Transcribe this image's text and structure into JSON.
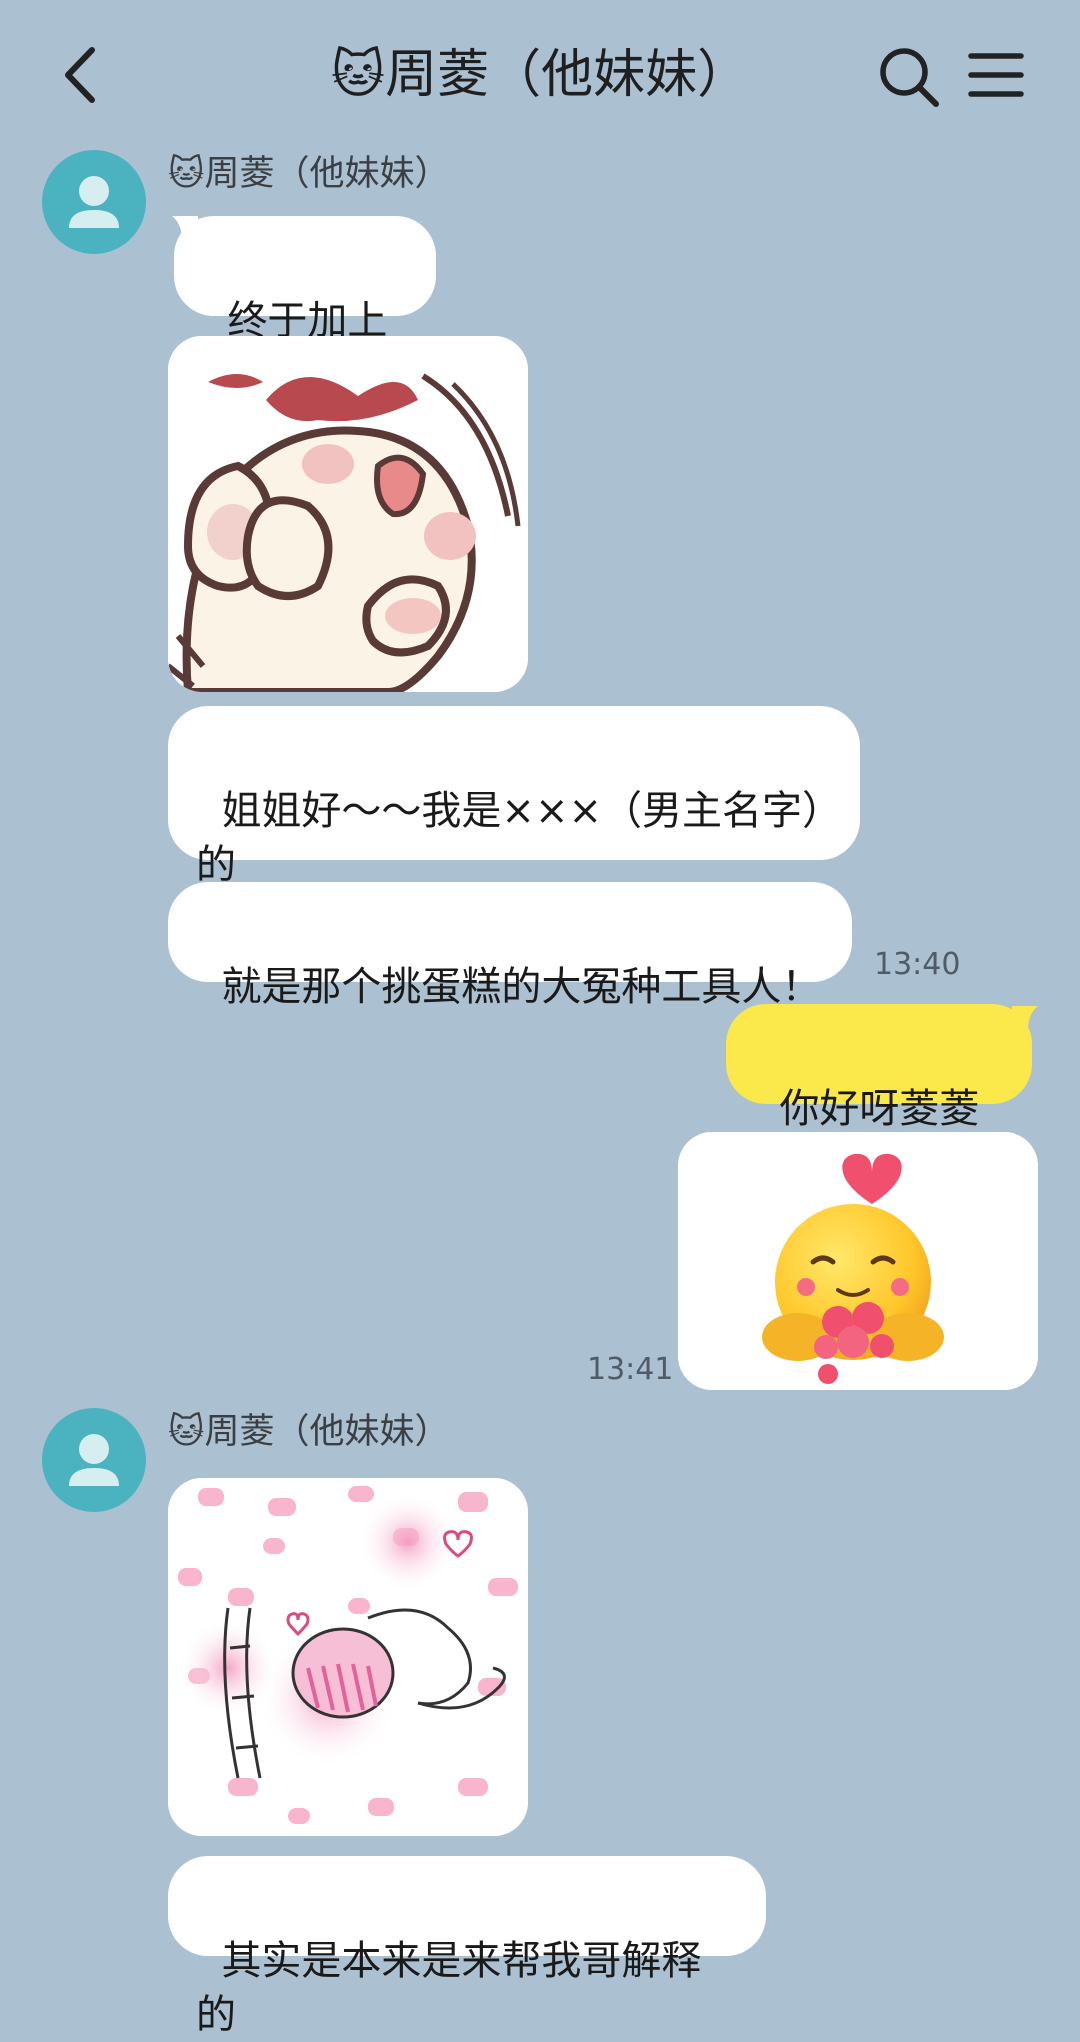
{
  "header": {
    "back_icon": "chevron-left-icon",
    "title_emoji": "🐱",
    "title": "周菱（他妹妹）",
    "search_icon": "search-icon",
    "menu_icon": "menu-icon"
  },
  "colors": {
    "background": "#abc1d1",
    "incoming_bubble": "#ffffff",
    "outgoing_bubble": "#fbe84a",
    "avatar": "#4bb3bf"
  },
  "messages": {
    "group1": {
      "sender_emoji": "🐱",
      "sender_name": "周菱（他妹妹）",
      "msg1": "终于加上啦",
      "sticker1": "cat-paws-sticker",
      "msg2": "姐姐好～～我是×××（男主名字）的\n堂妹周菱",
      "msg3": "就是那个挑蛋糕的大冤种工具人！",
      "time": "13:40"
    },
    "mine": {
      "msg1": "你好呀菱菱～",
      "sticker": "hug-hearts-emoji-sticker",
      "time": "13:41"
    },
    "group2": {
      "sender_emoji": "🐱",
      "sender_name": "周菱（他妹妹）",
      "sticker": "pink-hearts-bow-sticker",
      "msg1": "其实是本来是来帮我哥解释的"
    }
  }
}
